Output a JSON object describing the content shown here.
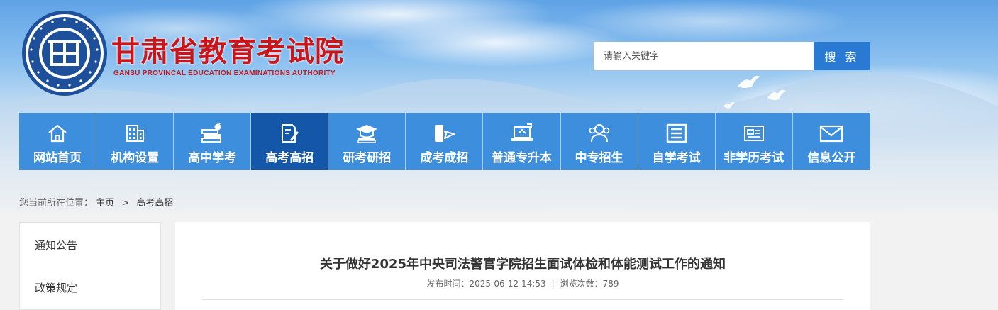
{
  "site": {
    "title_cn": "甘肃省教育考试院",
    "title_en": "GANSU PROVINCAL EDUCATION EXAMINATIONS AUTHORITY",
    "seal_text": "甘肃省教育考试院 GANSU PROVINCAL EDUCATION EXAMINATIONS AUTHORITY",
    "brand_color": "#c8161d"
  },
  "search": {
    "placeholder": "请输入关键字",
    "button_label": "搜 索",
    "button_color": "#2a7ad4"
  },
  "nav": {
    "bg_color": "#3d8fde",
    "active_color": "#1456a8",
    "items": [
      {
        "label": "网站首页",
        "icon": "home-icon"
      },
      {
        "label": "机构设置",
        "icon": "building-icon"
      },
      {
        "label": "高中学考",
        "icon": "books-apple-icon"
      },
      {
        "label": "高考高招",
        "icon": "document-pen-icon",
        "active": true
      },
      {
        "label": "研考研招",
        "icon": "graduation-cap-icon"
      },
      {
        "label": "成考成招",
        "icon": "phone-send-icon"
      },
      {
        "label": "普通专升本",
        "icon": "laptop-upgrade-icon"
      },
      {
        "label": "中专招生",
        "icon": "people-icon"
      },
      {
        "label": "自学考试",
        "icon": "book-lines-icon"
      },
      {
        "label": "非学历考试",
        "icon": "id-card-icon"
      },
      {
        "label": "信息公开",
        "icon": "envelope-icon"
      }
    ]
  },
  "breadcrumb": {
    "prefix": "您当前所在位置：",
    "home": "主页",
    "separator": ">",
    "current": "高考高招"
  },
  "sidebar": {
    "items": [
      {
        "label": "通知公告"
      },
      {
        "label": "政策规定"
      }
    ]
  },
  "article": {
    "title": "关于做好2025年中央司法警官学院招生面试体检和体能测试工作的通知",
    "publish_label": "发布时间：",
    "publish_time": "2025-06-12 14:53",
    "divider": "|",
    "views_label": "浏览次数：",
    "views": "789"
  }
}
